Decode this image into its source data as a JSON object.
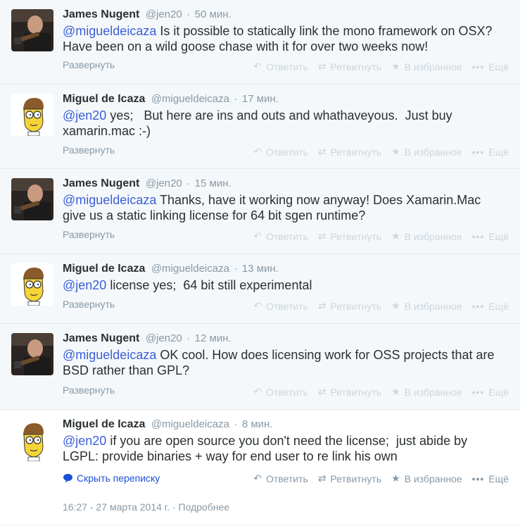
{
  "tweets": [
    {
      "name": "James Nugent",
      "handle": "@jen20",
      "time": "50 мин.",
      "mention": "@migueldeicaza",
      "text": " Is it possible to statically link the mono framework on OSX? Have been on a wild goose chase with it for over two weeks now!",
      "expand": "Развернуть"
    },
    {
      "name": "Miguel de Icaza",
      "handle": "@migueldeicaza",
      "time": "17 мин.",
      "mention": "@jen20",
      "text": " yes;   But here are ins and outs and whathaveyous.  Just buy xamarin.mac :-)",
      "expand": "Развернуть"
    },
    {
      "name": "James Nugent",
      "handle": "@jen20",
      "time": "15 мин.",
      "mention": "@migueldeicaza",
      "text": " Thanks, have it working now anyway! Does Xamarin.Mac give us a static linking license for 64 bit sgen runtime?",
      "expand": "Развернуть"
    },
    {
      "name": "Miguel de Icaza",
      "handle": "@migueldeicaza",
      "time": "13 мин.",
      "mention": "@jen20",
      "text": " license yes;  64 bit still experimental",
      "expand": "Развернуть"
    },
    {
      "name": "James Nugent",
      "handle": "@jen20",
      "time": "12 мин.",
      "mention": "@migueldeicaza",
      "text": " OK cool. How does licensing work for OSS projects that are BSD rather than GPL?",
      "expand": "Развернуть"
    },
    {
      "name": "Miguel de Icaza",
      "handle": "@migueldeicaza",
      "time": "8 мин.",
      "mention": "@jen20",
      "text": " if you are open source you don't need the license;  just abide by LGPL: provide binaries + way for end user to re link his own",
      "hide": "Скрыть переписку",
      "datetime": "16:27 - 27 марта 2014 г.",
      "details": "Подробнее"
    }
  ],
  "actions": {
    "reply": "Ответить",
    "retweet": "Ретвитнуть",
    "favorite": "В избранное",
    "more": "Ещё"
  },
  "separator": "·",
  "colors": {
    "link": "#3b5ed8",
    "muted": "#8899a6",
    "faded": "#ccd6dd"
  }
}
